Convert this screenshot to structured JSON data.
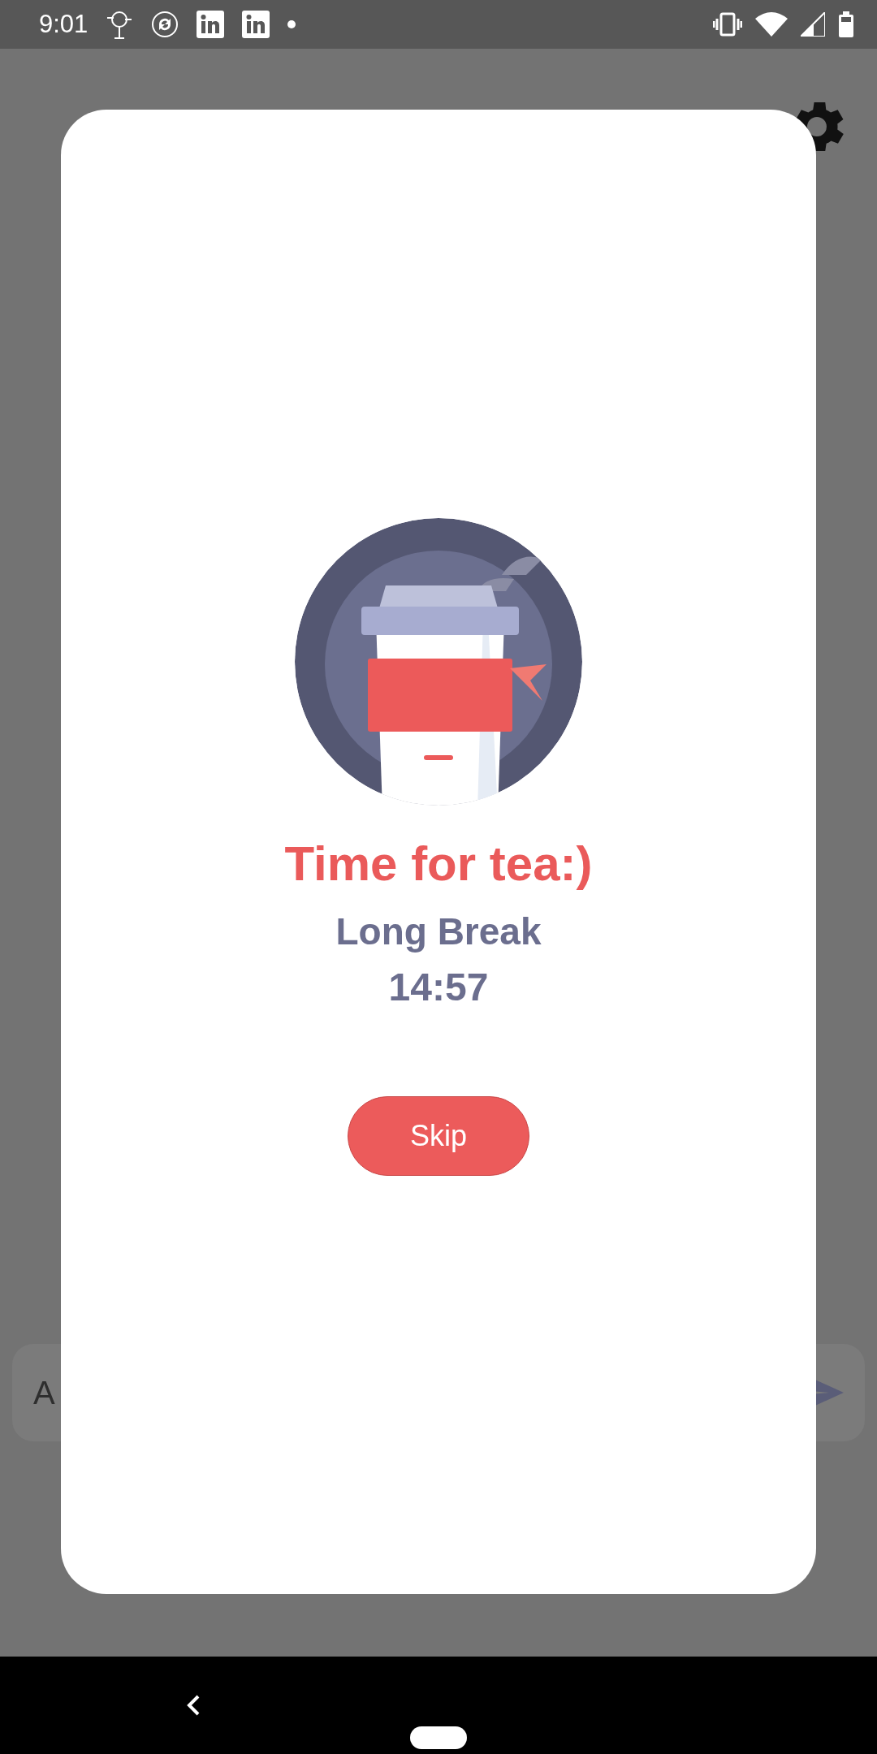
{
  "status_bar": {
    "time": "9:01"
  },
  "background": {
    "task_input": {
      "placeholder": "A"
    }
  },
  "dialog": {
    "title": "Time for tea:)",
    "mode": "Long Break",
    "timer": "14:57",
    "button": "Skip"
  }
}
